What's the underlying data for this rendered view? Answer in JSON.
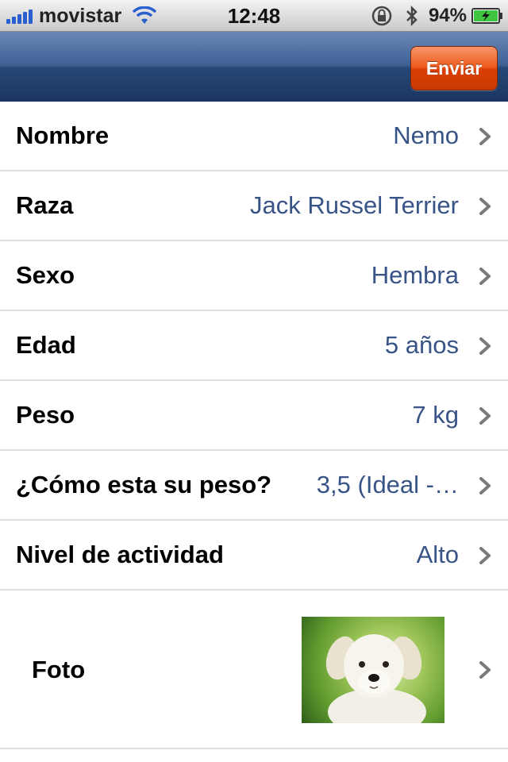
{
  "status_bar": {
    "carrier": "movistar",
    "time": "12:48",
    "battery_percent": "94%",
    "signal_bars": 5
  },
  "nav_bar": {
    "send_button": "Enviar"
  },
  "rows": [
    {
      "label": "Nombre",
      "value": "Nemo"
    },
    {
      "label": "Raza",
      "value": "Jack Russel Terrier"
    },
    {
      "label": "Sexo",
      "value": "Hembra"
    },
    {
      "label": "Edad",
      "value": "5 años"
    },
    {
      "label": "Peso",
      "value": "7 kg"
    },
    {
      "label": "¿Cómo esta su peso?",
      "value": "3,5 (Ideal -…"
    },
    {
      "label": "Nivel de actividad",
      "value": "Alto"
    }
  ],
  "photo_row": {
    "label": "Foto"
  },
  "colors": {
    "value_text": "#385487",
    "nav_bar": "#274877",
    "send_button": "#dc3f04"
  }
}
